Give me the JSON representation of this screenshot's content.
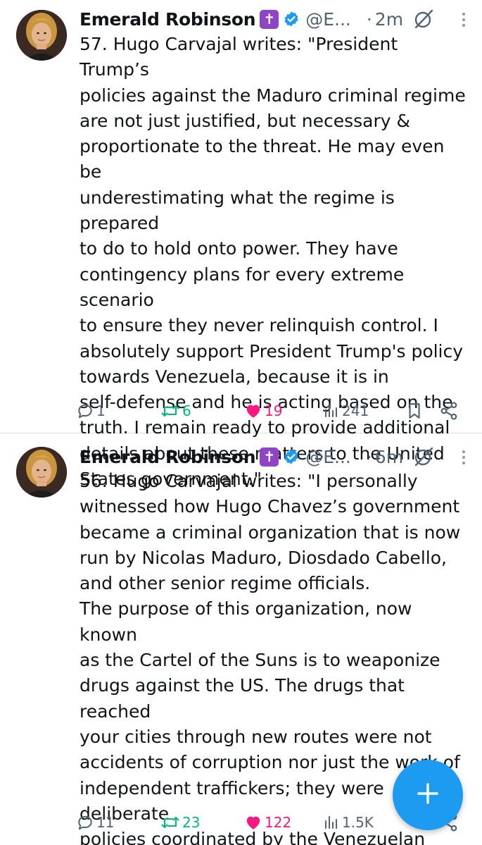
{
  "tweets": [
    {
      "author_name": "Emerald Robinson",
      "author_badge": "✝",
      "handle": "@E...",
      "separator": "·",
      "time": "2m",
      "text": "57. Hugo Carvajal writes: \"President Trump’s\npolicies against the Maduro criminal regime\nare not just justified, but necessary &\nproportionate to the threat. He may even be\nunderestimating what the regime is prepared\nto do to hold onto power. They have\ncontingency plans for every extreme scenario\nto ensure they never relinquish control. I\nabsolutely support President Trump's policy\ntowards Venezuela, because it is in\nself-defense and he is acting based on the\ntruth. I remain ready to provide additional\ndetails about these matters to the United\nStates government.\"",
      "replies": "1",
      "reposts": "6",
      "likes": "19",
      "views": "241"
    },
    {
      "author_name": "Emerald Robinson",
      "author_badge": "✝",
      "handle": "@E...",
      "separator": "·",
      "time": "6m",
      "text": "56. Hugo Carvajal writes: \"I personally\nwitnessed how Hugo Chavez’s government\nbecame a criminal organization that is now\nrun by Nicolas Maduro, Diosdado Cabello,\nand other senior regime officials.\nThe purpose of this organization, now known\nas the Cartel of the Suns is to weaponize\ndrugs against the US. The drugs that reached\nyour cities through new routes were not\naccidents of corruption nor just the work of\nindependent traffickers; they were deliberate\npolicies coordinated by the Venezuelan\nregime against the US.\"",
      "replies": "11",
      "reposts": "23",
      "likes": "122",
      "views": "1.5K"
    }
  ],
  "icons": {
    "verified": "verified-badge-icon",
    "grok": "grok-icon",
    "more": "more-options-icon",
    "reply": "reply-icon",
    "repost": "repost-icon",
    "like": "heart-filled-icon",
    "views": "views-icon",
    "bookmark": "bookmark-icon",
    "share": "share-icon",
    "compose": "plus-icon"
  },
  "colors": {
    "text": "#0f1419",
    "muted": "#536471",
    "verified": "#1d9bf0",
    "repost_active": "#00ba7c",
    "like_active": "#f91880",
    "badge_purple": "#8e44c4",
    "fab": "#1d9bf0",
    "divider": "#d9dee2"
  }
}
